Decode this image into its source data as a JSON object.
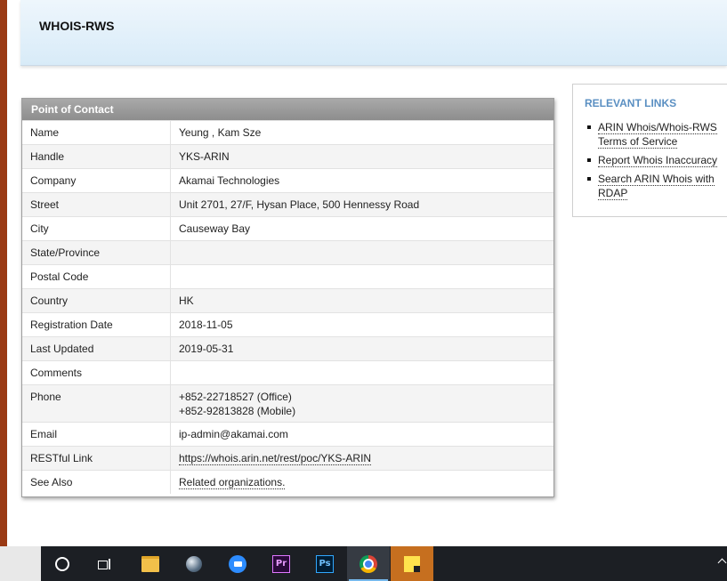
{
  "header": {
    "title": "WHOIS-RWS"
  },
  "poc": {
    "title": "Point of Contact",
    "rows": [
      {
        "label": "Name",
        "value": "Yeung , Kam Sze"
      },
      {
        "label": "Handle",
        "value": "YKS-ARIN"
      },
      {
        "label": "Company",
        "value": "Akamai Technologies"
      },
      {
        "label": "Street",
        "value": "Unit 2701, 27/F, Hysan Place, 500 Hennessy Road"
      },
      {
        "label": "City",
        "value": "Causeway Bay"
      },
      {
        "label": "State/Province",
        "value": ""
      },
      {
        "label": "Postal Code",
        "value": ""
      },
      {
        "label": "Country",
        "value": "HK"
      },
      {
        "label": "Registration Date",
        "value": "2018-11-05"
      },
      {
        "label": "Last Updated",
        "value": "2019-05-31"
      },
      {
        "label": "Comments",
        "value": ""
      },
      {
        "label": "Phone",
        "value": "+852-22718527 (Office)",
        "value2": "+852-92813828 (Mobile)"
      },
      {
        "label": "Email",
        "value": "ip-admin@akamai.com"
      },
      {
        "label": "RESTful Link",
        "value": "https://whois.arin.net/rest/poc/YKS-ARIN"
      },
      {
        "label": "See Also",
        "value": "Related organizations."
      }
    ]
  },
  "relevant_links": {
    "title": "RELEVANT LINKS",
    "items": [
      {
        "label": "ARIN Whois/Whois-RWS Terms of Service"
      },
      {
        "label": "Report Whois Inaccuracy"
      },
      {
        "label": "Search ARIN Whois with RDAP"
      }
    ]
  },
  "taskbar": {
    "icons": [
      "cortana-icon",
      "task-view-icon",
      "file-explorer-icon",
      "globe-app-icon",
      "zoom-icon",
      "premiere-pro-icon",
      "photoshop-icon",
      "chrome-icon",
      "sticky-notes-icon"
    ],
    "premiere_label": "Pr",
    "photoshop_label": "Ps"
  }
}
